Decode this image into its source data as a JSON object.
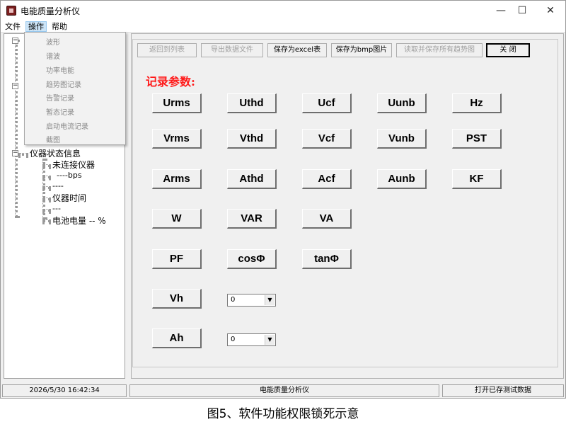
{
  "window": {
    "title": "电能质量分析仪",
    "minimize": "—",
    "maximize": "☐",
    "close": "✕"
  },
  "menubar": {
    "items": [
      "文件",
      "操作",
      "帮助"
    ],
    "active_index": 1
  },
  "dropdown": {
    "items": [
      "波形",
      "谐波",
      "功率电能",
      "趋势图记录",
      "告警记录",
      "暂态记录",
      "启动电流记录",
      "截图"
    ]
  },
  "tree": {
    "status_node": "仪器状态信息",
    "children": [
      "未连接仪器",
      "----bps",
      "----",
      "仪器时间",
      "---",
      "电池电量 -- %"
    ]
  },
  "toolbar": {
    "back_to_list": "返回到列表",
    "export_data": "导出数据文件",
    "save_excel": "保存为excel表",
    "save_bmp": "保存为bmp图片",
    "read_save_trends": "读取并保存所有趋势图",
    "close": "关 闭"
  },
  "params": {
    "section_title": "记录参数:",
    "row1": [
      "Urms",
      "Uthd",
      "Ucf",
      "Uunb",
      "Hz"
    ],
    "row2": [
      "Vrms",
      "Vthd",
      "Vcf",
      "Vunb",
      "PST"
    ],
    "row3": [
      "Arms",
      "Athd",
      "Acf",
      "Aunb",
      "KF"
    ],
    "row4": [
      "W",
      "VAR",
      "VA"
    ],
    "row5": [
      "PF",
      "cosΦ",
      "tanΦ"
    ],
    "vh_label": "Vh",
    "vh_value": "0",
    "ah_label": "Ah",
    "ah_value": "0"
  },
  "statusbar": {
    "datetime": "2026/5/30 16:42:34",
    "app_name": "电能质量分析仪",
    "action": "打开已存测试数据"
  },
  "caption": "图5、软件功能权限锁死示意",
  "colors": {
    "section_title": "#ff1a1a",
    "disabled_text": "#a0a0a0",
    "window_bg": "#f0f0f0"
  }
}
